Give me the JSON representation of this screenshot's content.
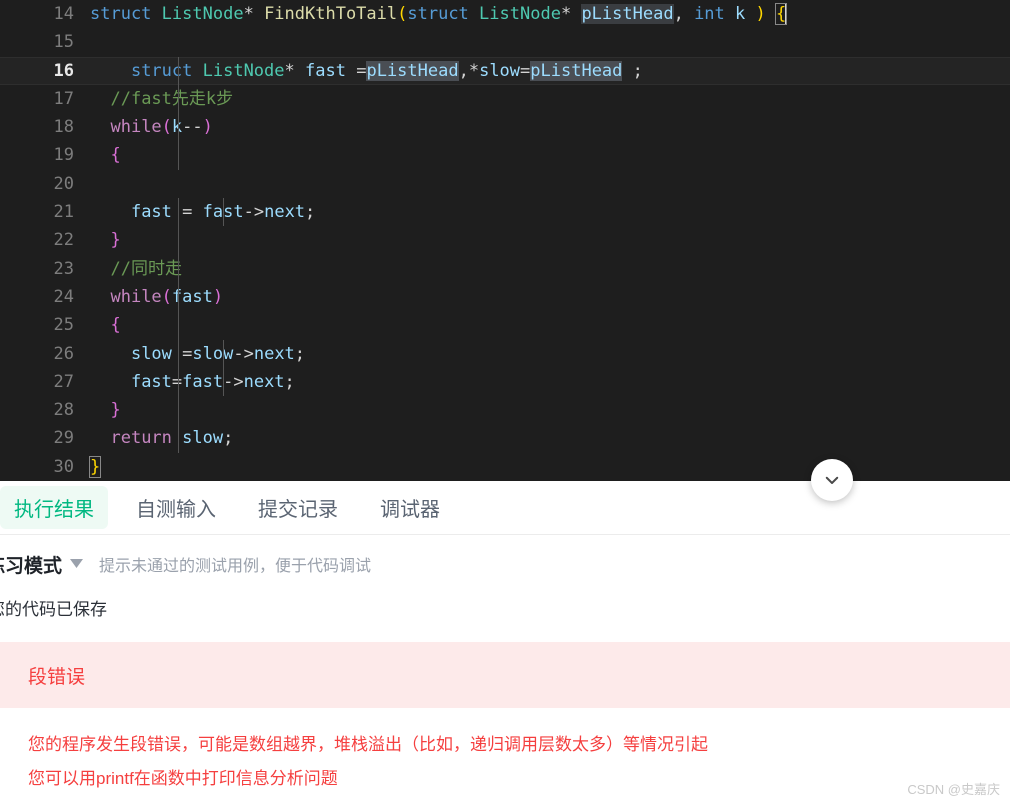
{
  "editor": {
    "language": "c",
    "theme_bg": "#1e1e1e",
    "active_line": 16,
    "lines": [
      {
        "no": "14",
        "text": "struct ListNode* FindKthToTail(struct ListNode* pListHead, int k ) {"
      },
      {
        "no": "15",
        "text": ""
      },
      {
        "no": "16",
        "text": "    struct ListNode* fast =pListHead,*slow=pListHead ;"
      },
      {
        "no": "17",
        "text": "  //fast先走k步"
      },
      {
        "no": "18",
        "text": "  while(k--)"
      },
      {
        "no": "19",
        "text": "  {"
      },
      {
        "no": "20",
        "text": ""
      },
      {
        "no": "21",
        "text": "    fast = fast->next;"
      },
      {
        "no": "22",
        "text": "  }"
      },
      {
        "no": "23",
        "text": "  //同时走"
      },
      {
        "no": "24",
        "text": "  while(fast)"
      },
      {
        "no": "25",
        "text": "  {"
      },
      {
        "no": "26",
        "text": "    slow =slow->next;"
      },
      {
        "no": "27",
        "text": "    fast=fast->next;"
      },
      {
        "no": "28",
        "text": "  }"
      },
      {
        "no": "29",
        "text": "  return slow;"
      },
      {
        "no": "30",
        "text": "}"
      }
    ],
    "tokens": {
      "kw_struct": "struct",
      "kw_int": "int",
      "kw_return": "return",
      "kw_while": "while",
      "type_listnode": "ListNode",
      "fn_name": "FindKthToTail",
      "var_plisthead": "pListHead",
      "var_fast": "fast",
      "var_slow": "slow",
      "var_k": "k",
      "member_next": "next",
      "comment_17": "//fast先走k步",
      "comment_23": "//同时走"
    },
    "collapse_button_icon": "chevron-down-icon"
  },
  "panel": {
    "tabs": [
      {
        "label": "执行结果",
        "active": true
      },
      {
        "label": "自测输入",
        "active": false
      },
      {
        "label": "提交记录",
        "active": false
      },
      {
        "label": "调试器",
        "active": false
      }
    ],
    "mode": {
      "label": "练习模式",
      "caret_icon": "caret-down-icon",
      "hint": "提示未通过的测试用例，便于代码调试"
    },
    "saved_text": "您的代码已保存",
    "error": {
      "title": "段错误",
      "lines": [
        "您的程序发生段错误，可能是数组越界，堆栈溢出（比如，递归调用层数太多）等情况引起",
        "您可以用printf在函数中打印信息分析问题"
      ],
      "bg_color": "#fdeaea",
      "text_color": "#f53f3f"
    }
  },
  "watermark": "CSDN @史嘉庆",
  "colors": {
    "accent_green": "#00b881",
    "tab_active_bg": "#eefaf4",
    "error_red": "#f53f3f",
    "editor_bg": "#1e1e1e",
    "active_line_bg": "#242424"
  }
}
